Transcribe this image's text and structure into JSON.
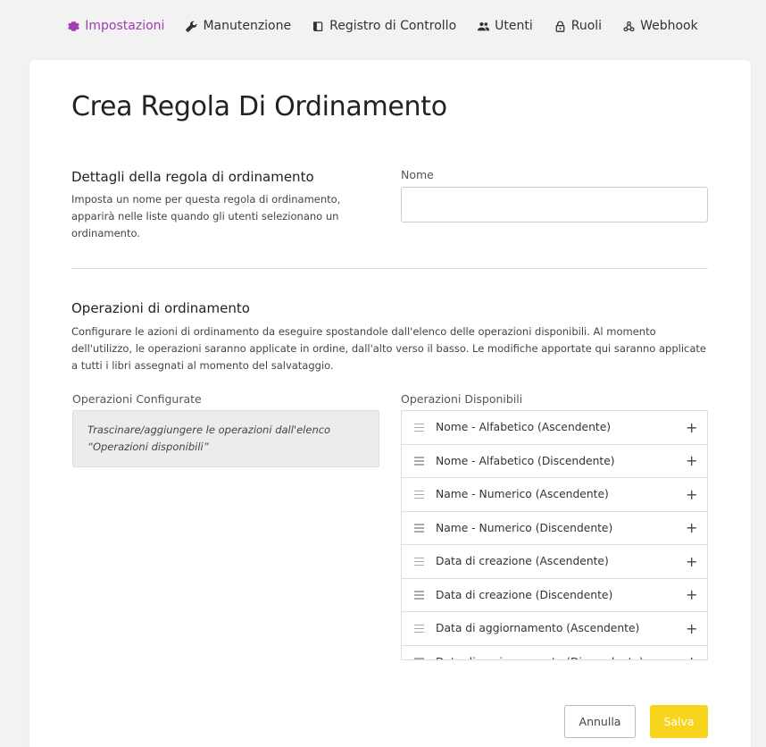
{
  "nav": {
    "items": [
      {
        "label": "Impostazioni",
        "icon": "gear-icon",
        "active": true
      },
      {
        "label": "Manutenzione",
        "icon": "wrench-icon",
        "active": false
      },
      {
        "label": "Registro di Controllo",
        "icon": "book-icon",
        "active": false
      },
      {
        "label": "Utenti",
        "icon": "users-icon",
        "active": false
      },
      {
        "label": "Ruoli",
        "icon": "lock-icon",
        "active": false
      },
      {
        "label": "Webhook",
        "icon": "webhook-icon",
        "active": false
      }
    ],
    "active_color": "#a23cb4"
  },
  "page": {
    "title": "Crea Regola Di Ordinamento"
  },
  "details": {
    "title": "Dettagli della regola di ordinamento",
    "description": "Imposta un nome per questa regola di ordinamento, apparirà nelle liste quando gli utenti selezionano un ordinamento.",
    "name_label": "Nome",
    "name_value": ""
  },
  "operations": {
    "title": "Operazioni di ordinamento",
    "description": "Configurare le azioni di ordinamento da eseguire spostandole dall'elenco delle operazioni disponibili. Al momento dell'utilizzo, le operazioni saranno applicate in ordine, dall'alto verso il basso. Le modifiche apportate qui saranno applicate a tutti i libri assegnati al momento del salvataggio.",
    "configured_label": "Operazioni Configurate",
    "configured_empty": "Trascinare/aggiungere le operazioni dall'elenco “Operazioni disponibili”",
    "available_label": "Operazioni Disponibili",
    "available": [
      "Nome - Alfabetico (Ascendente)",
      "Nome - Alfabetico (Discendente)",
      "Name - Numerico (Ascendente)",
      "Name - Numerico (Discendente)",
      "Data di creazione (Ascendente)",
      "Data di creazione (Discendente)",
      "Data di aggiornamento (Ascendente)",
      "Data di aggiornamento (Discendente)"
    ]
  },
  "actions": {
    "cancel": "Annulla",
    "save": "Salva",
    "save_color": "#f7d51d"
  }
}
